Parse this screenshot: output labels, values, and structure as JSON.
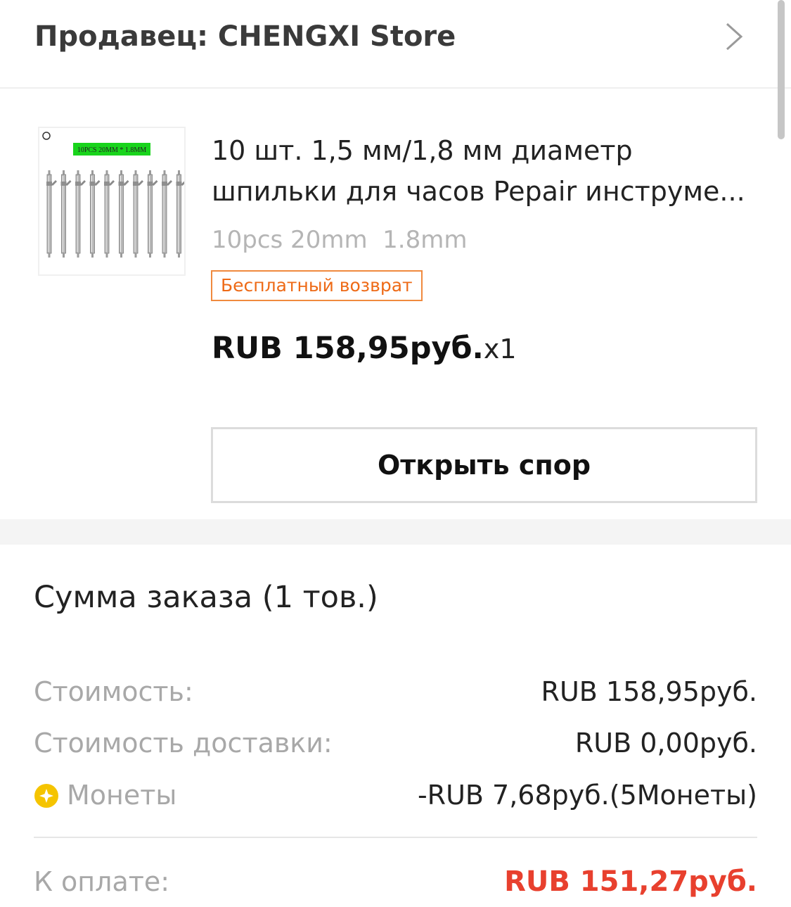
{
  "seller": {
    "label": "Продавец: CHENGXI Store"
  },
  "product": {
    "title_line1": "10 шт. 1,5 мм/1,8 мм диаметр",
    "title_line2": "шпильки для часов Pepair инструме...",
    "variant": "10pcs 20mm  1.8mm",
    "badge": "Бесплатный возврат",
    "price": "RUB 158,95руб.",
    "quantity": "x1",
    "thumb_label": "10PCS 20MM * 1.8MM",
    "pin_count": 10
  },
  "actions": {
    "dispute_label": "Открыть спор"
  },
  "summary": {
    "title": "Сумма заказа (1 тов.)",
    "rows": [
      {
        "label": "Стоимость:",
        "value": "RUB 158,95руб."
      },
      {
        "label": "Стоимость доставки:",
        "value": "RUB 0,00руб."
      },
      {
        "label": "Монеты",
        "value": "-RUB 7,68руб.(5Монеты)"
      }
    ],
    "total_label": "К оплате:",
    "total_value": "RUB 151,27руб."
  },
  "colors": {
    "accent_total": "#e8402e",
    "badge_orange": "#ee6a16",
    "coin_yellow": "#f5c400"
  },
  "icons": {
    "chevron": "chevron-right-icon",
    "coin": "coin-icon"
  }
}
